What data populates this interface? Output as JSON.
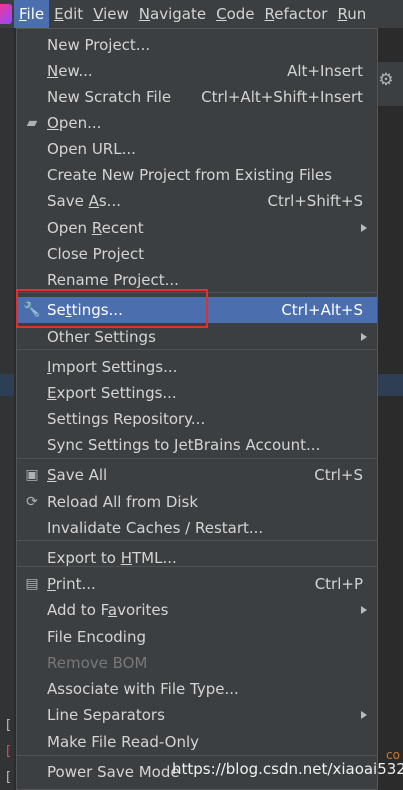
{
  "menubar": {
    "items": [
      {
        "label": "File",
        "mnemonic": "F",
        "rest": "ile",
        "active": true
      },
      {
        "label": "Edit",
        "mnemonic": "E",
        "rest": "dit"
      },
      {
        "label": "View",
        "mnemonic": "V",
        "rest": "iew"
      },
      {
        "label": "Navigate",
        "mnemonic": "N",
        "rest": "avigate"
      },
      {
        "label": "Code",
        "mnemonic": "C",
        "rest": "ode"
      },
      {
        "label": "Refactor",
        "mnemonic": "R",
        "rest": "efactor"
      },
      {
        "label": "Run",
        "mnemonic": "R",
        "rest": "un"
      }
    ]
  },
  "file_menu": {
    "items": [
      {
        "pre": "",
        "mn": "",
        "post": "New Project...",
        "shortcut": ""
      },
      {
        "pre": "",
        "mn": "N",
        "post": "ew...",
        "shortcut": "Alt+Insert"
      },
      {
        "pre": "",
        "mn": "",
        "post": "New Scratch File",
        "shortcut": "Ctrl+Alt+Shift+Insert"
      },
      {
        "pre": "",
        "mn": "O",
        "post": "pen...",
        "shortcut": "",
        "icon": "folder-icon"
      },
      {
        "pre": "",
        "mn": "",
        "post": "Open URL...",
        "shortcut": ""
      },
      {
        "pre": "",
        "mn": "",
        "post": "Create New Project from Existing Files",
        "shortcut": ""
      },
      {
        "pre": "Save ",
        "mn": "A",
        "post": "s...",
        "shortcut": "Ctrl+Shift+S"
      },
      {
        "pre": "Open ",
        "mn": "R",
        "post": "ecent",
        "shortcut": "",
        "submenu": true
      },
      {
        "pre": "Close Pro",
        "mn": "j",
        "post": "ect",
        "shortcut": ""
      },
      {
        "pre": "Rename Project...",
        "mn": "",
        "post": "",
        "shortcut": ""
      },
      {
        "pre": "Se",
        "mn": "t",
        "post": "tings...",
        "shortcut": "Ctrl+Alt+S",
        "selected": true,
        "icon": "wrench-icon"
      },
      {
        "pre": "Other Settings",
        "mn": "",
        "post": "",
        "shortcut": "",
        "submenu": true
      },
      {
        "pre": "",
        "mn": "I",
        "post": "mport Settings...",
        "shortcut": ""
      },
      {
        "pre": "",
        "mn": "E",
        "post": "xport Settings...",
        "shortcut": ""
      },
      {
        "pre": "Settings Repository...",
        "mn": "",
        "post": "",
        "shortcut": ""
      },
      {
        "pre": "Sync Settings to JetBrains Account...",
        "mn": "",
        "post": "",
        "shortcut": ""
      },
      {
        "pre": "",
        "mn": "S",
        "post": "ave All",
        "shortcut": "Ctrl+S",
        "icon": "save-icon"
      },
      {
        "pre": "Reload All from Disk",
        "mn": "",
        "post": "",
        "shortcut": "",
        "icon": "reload-icon"
      },
      {
        "pre": "Invalidate Caches / Restart...",
        "mn": "",
        "post": "",
        "shortcut": ""
      },
      {
        "pre": "Export to ",
        "mn": "H",
        "post": "TML...",
        "shortcut": ""
      },
      {
        "pre": "",
        "mn": "P",
        "post": "rint...",
        "shortcut": "Ctrl+P",
        "icon": "print-icon"
      },
      {
        "pre": "Add to F",
        "mn": "a",
        "post": "vorites",
        "shortcut": "",
        "submenu": true
      },
      {
        "pre": "File Encoding",
        "mn": "",
        "post": "",
        "shortcut": ""
      },
      {
        "pre": "Remove BOM",
        "mn": "",
        "post": "",
        "shortcut": "",
        "disabled": true
      },
      {
        "pre": "Associate with File Type...",
        "mn": "",
        "post": "",
        "shortcut": ""
      },
      {
        "pre": "Line Separators",
        "mn": "",
        "post": "",
        "shortcut": "",
        "submenu": true
      },
      {
        "pre": "Make File Read-Only",
        "mn": "",
        "post": "",
        "shortcut": ""
      },
      {
        "pre": "Power Save Mode",
        "mn": "",
        "post": "",
        "shortcut": ""
      }
    ]
  },
  "background": {
    "code_fragment": "co",
    "brackets": [
      "[",
      "[",
      "["
    ]
  },
  "watermark": "https://blog.csdn.net/xiaoai5324",
  "colors": {
    "menu_bg": "#3c3f41",
    "selection": "#4b6eaf",
    "highlight_box": "#e03030"
  }
}
